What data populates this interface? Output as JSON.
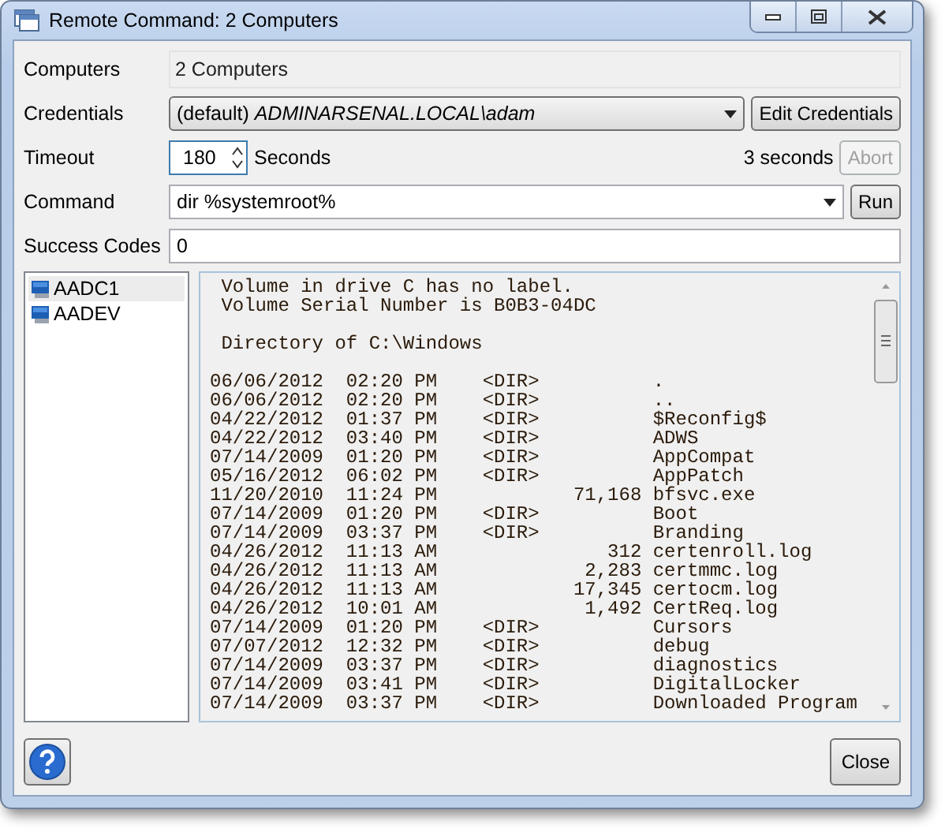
{
  "window": {
    "title": "Remote Command: 2 Computers"
  },
  "computers": {
    "label": "Computers",
    "value": "2 Computers"
  },
  "credentials": {
    "label": "Credentials",
    "value": "(default) *ADMINARSENAL.LOCAL\\adam*",
    "button": "Edit Credentials"
  },
  "timeout": {
    "label": "Timeout",
    "value": "180",
    "unit": "Seconds",
    "elapsed": "3 seconds",
    "abort": {
      "label": "Abort",
      "disabled": true
    }
  },
  "command": {
    "label": "Command",
    "value": "dir %systemroot%",
    "button": "Run"
  },
  "success_codes": {
    "label": "Success Codes",
    "value": "0"
  },
  "computer_list": [
    {
      "name": "AADC1",
      "selected": true
    },
    {
      "name": "AADEV",
      "selected": false
    }
  ],
  "output": [
    [
      " Volume in drive C has no label.",
      " Volume Serial Number is B0B3-04DC"
    ],
    [
      " Directory of C:\\Windows"
    ],
    [
      "06/06/2012  02:20 PM    <DIR>          .",
      "06/06/2012  02:20 PM    <DIR>          ..",
      "04/22/2012  01:37 PM    <DIR>          $Reconfig$",
      "04/22/2012  03:40 PM    <DIR>          ADWS",
      "07/14/2009  01:20 PM    <DIR>          AppCompat",
      "05/16/2012  06:02 PM    <DIR>          AppPatch",
      "11/20/2010  11:24 PM            71,168 bfsvc.exe",
      "07/14/2009  01:20 PM    <DIR>          Boot",
      "07/14/2009  03:37 PM    <DIR>          Branding",
      "04/26/2012  11:13 AM               312 certenroll.log",
      "04/26/2012  11:13 AM             2,283 certmmc.log",
      "04/26/2012  11:13 AM            17,345 certocm.log",
      "04/26/2012  10:01 AM             1,492 CertReq.log",
      "07/14/2009  01:20 PM    <DIR>          Cursors",
      "07/07/2012  12:32 PM    <DIR>          debug",
      "07/14/2009  03:37 PM    <DIR>          diagnostics",
      "07/14/2009  03:41 PM    <DIR>          DigitalLocker",
      "07/14/2009  03:37 PM    <DIR>          Downloaded Program"
    ]
  ],
  "footer": {
    "close": "Close"
  }
}
